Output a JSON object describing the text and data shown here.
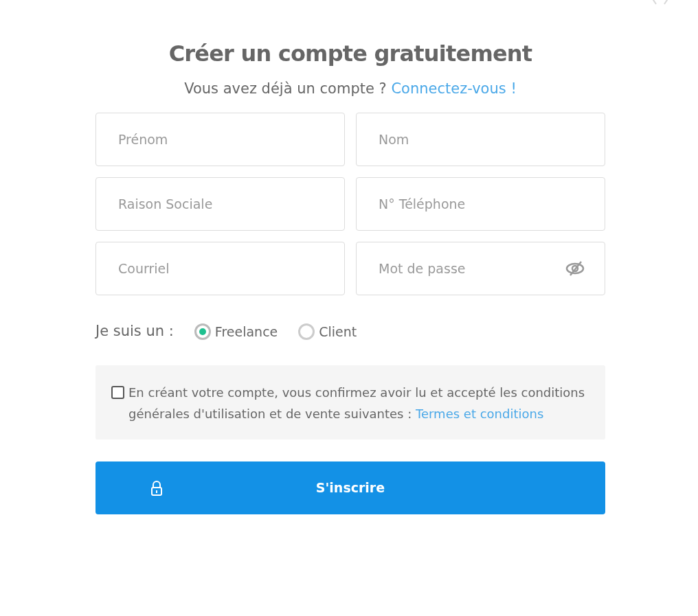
{
  "title": "Créer un compte gratuitement",
  "subtitle": {
    "text": "Vous avez déjà un compte ?",
    "link": "Connectez-vous !"
  },
  "fields": [
    {
      "placeholder": "Prénom",
      "kind": "text"
    },
    {
      "placeholder": "Nom",
      "kind": "text"
    },
    {
      "placeholder": "Raison Sociale",
      "kind": "text"
    },
    {
      "placeholder": "N° Téléphone",
      "kind": "text"
    },
    {
      "placeholder": "Courriel",
      "kind": "text"
    },
    {
      "placeholder": "Mot de passe",
      "kind": "password"
    }
  ],
  "role": {
    "label": "Je suis un :",
    "options": [
      {
        "label": "Freelance",
        "selected": true
      },
      {
        "label": "Client",
        "selected": false
      }
    ]
  },
  "terms": {
    "checked": false,
    "text": "En créant votre compte, vous confirmez avoir lu et accepté les conditions générales d'utilisation et de vente suivantes :",
    "link": "Termes et conditions"
  },
  "submit": {
    "label": "S'inscrire"
  }
}
